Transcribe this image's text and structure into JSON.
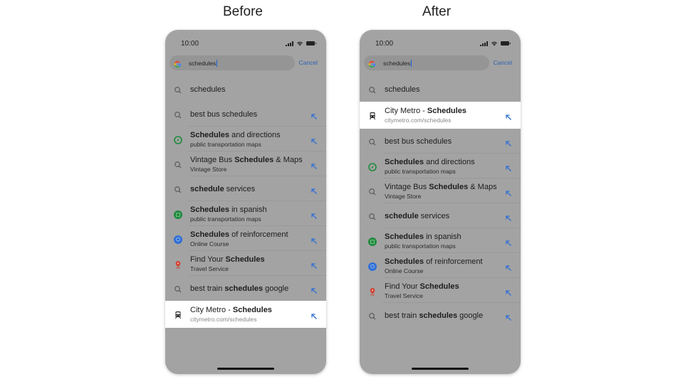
{
  "panels": [
    {
      "title": "Before",
      "status": {
        "time": "10:00"
      },
      "search": {
        "query": "schedules",
        "cancel_label": "Cancel"
      },
      "rows": [
        {
          "icon": "search-icon",
          "parts": [
            [
              "schedules",
              false
            ]
          ],
          "subtitle": null,
          "arrow": false,
          "highlight": false
        },
        {
          "icon": "search-icon",
          "parts": [
            [
              "best bus schedules",
              false
            ]
          ],
          "subtitle": null,
          "arrow": true,
          "highlight": false
        },
        {
          "icon": "compass-icon",
          "parts": [
            [
              "Schedules",
              true
            ],
            [
              " and directions",
              false
            ]
          ],
          "subtitle": "public transportation maps",
          "arrow": true,
          "highlight": false
        },
        {
          "icon": "search-icon",
          "parts": [
            [
              "Vintage Bus ",
              false
            ],
            [
              "Schedules",
              true
            ],
            [
              " & Maps",
              false
            ]
          ],
          "subtitle": "Vintage Store",
          "arrow": true,
          "highlight": false
        },
        {
          "icon": "search-icon",
          "parts": [
            [
              "schedule",
              true
            ],
            [
              " services",
              false
            ]
          ],
          "subtitle": null,
          "arrow": true,
          "highlight": false
        },
        {
          "icon": "calendar-icon",
          "parts": [
            [
              "Schedules",
              true
            ],
            [
              " in spanish",
              false
            ]
          ],
          "subtitle": "public transportation maps",
          "arrow": true,
          "highlight": false
        },
        {
          "icon": "course-icon",
          "parts": [
            [
              "Schedules",
              true
            ],
            [
              " of reinforcement",
              false
            ]
          ],
          "subtitle": "Online Course",
          "arrow": true,
          "highlight": false
        },
        {
          "icon": "location-pin-icon",
          "parts": [
            [
              "Find Your ",
              false
            ],
            [
              "Schedules",
              true
            ]
          ],
          "subtitle": "Travel Service",
          "arrow": true,
          "highlight": false
        },
        {
          "icon": "search-icon",
          "parts": [
            [
              "best train ",
              false
            ],
            [
              "schedules",
              true
            ],
            [
              " google",
              false
            ]
          ],
          "subtitle": null,
          "arrow": true,
          "highlight": false
        },
        {
          "icon": "train-icon",
          "parts": [
            [
              "City Metro -  ",
              false
            ],
            [
              "Schedules",
              true
            ]
          ],
          "subtitle": "citymetro.com/schedules",
          "arrow": true,
          "highlight": true
        }
      ]
    },
    {
      "title": "After",
      "status": {
        "time": "10:00"
      },
      "search": {
        "query": "schedules",
        "cancel_label": "Cancel"
      },
      "rows": [
        {
          "icon": "search-icon",
          "parts": [
            [
              "schedules",
              false
            ]
          ],
          "subtitle": null,
          "arrow": false,
          "highlight": false
        },
        {
          "icon": "train-icon",
          "parts": [
            [
              "City Metro -  ",
              false
            ],
            [
              "Schedules",
              true
            ]
          ],
          "subtitle": "citymetro.com/schedules",
          "arrow": true,
          "highlight": true
        },
        {
          "icon": "search-icon",
          "parts": [
            [
              "best bus schedules",
              false
            ]
          ],
          "subtitle": null,
          "arrow": true,
          "highlight": false
        },
        {
          "icon": "compass-icon",
          "parts": [
            [
              "Schedules",
              true
            ],
            [
              " and directions",
              false
            ]
          ],
          "subtitle": "public transportation maps",
          "arrow": true,
          "highlight": false
        },
        {
          "icon": "search-icon",
          "parts": [
            [
              "Vintage Bus ",
              false
            ],
            [
              "Schedules",
              true
            ],
            [
              " & Maps",
              false
            ]
          ],
          "subtitle": "Vintage Store",
          "arrow": true,
          "highlight": false
        },
        {
          "icon": "search-icon",
          "parts": [
            [
              "schedule",
              true
            ],
            [
              " services",
              false
            ]
          ],
          "subtitle": null,
          "arrow": true,
          "highlight": false
        },
        {
          "icon": "calendar-icon",
          "parts": [
            [
              "Schedules",
              true
            ],
            [
              " in spanish",
              false
            ]
          ],
          "subtitle": "public transportation maps",
          "arrow": true,
          "highlight": false
        },
        {
          "icon": "course-icon",
          "parts": [
            [
              "Schedules",
              true
            ],
            [
              " of reinforcement",
              false
            ]
          ],
          "subtitle": "Online Course",
          "arrow": true,
          "highlight": false
        },
        {
          "icon": "location-pin-icon",
          "parts": [
            [
              "Find Your ",
              false
            ],
            [
              "Schedules",
              true
            ]
          ],
          "subtitle": "Travel Service",
          "arrow": true,
          "highlight": false
        },
        {
          "icon": "search-icon",
          "parts": [
            [
              "best train ",
              false
            ],
            [
              "schedules",
              true
            ],
            [
              " google",
              false
            ]
          ],
          "subtitle": null,
          "arrow": true,
          "highlight": false
        }
      ]
    }
  ],
  "colors": {
    "accent_blue": "#2f6fd6",
    "compass_green": "#1e8a3c",
    "calendar_green": "#1e8a3c",
    "course_blue": "#2f6fd6",
    "pin_red": "#d04030",
    "overlay_gray": "#a3a3a3"
  }
}
